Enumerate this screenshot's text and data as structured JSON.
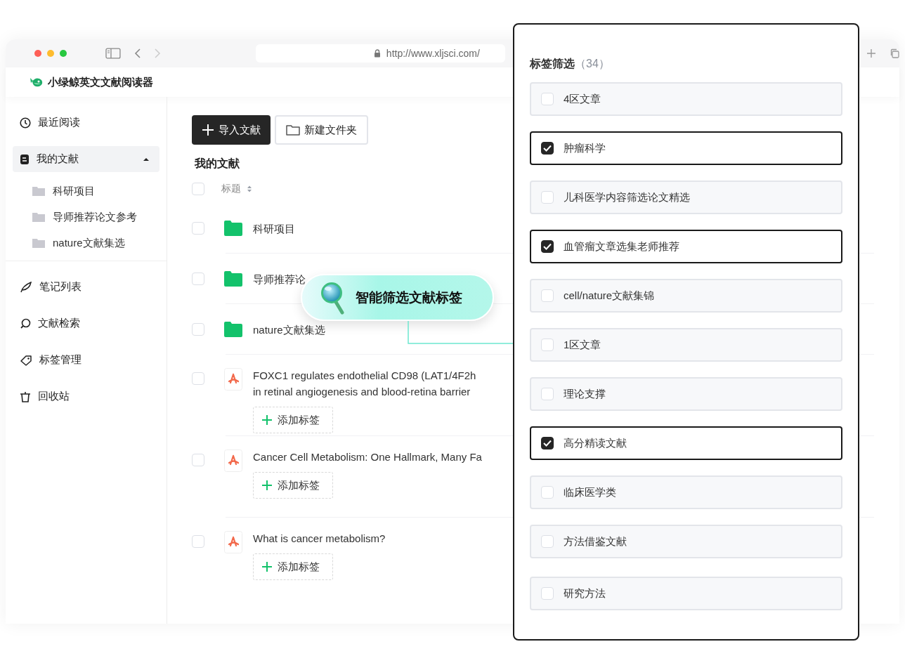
{
  "browser": {
    "url": "http://www.xljsci.com/"
  },
  "app": {
    "title": "小绿鲸英文文献阅读器"
  },
  "sidebar": {
    "items": [
      {
        "label": "最近阅读",
        "selected": false
      },
      {
        "label": "我的文献",
        "selected": true,
        "expanded": true,
        "children": [
          {
            "label": "科研项目"
          },
          {
            "label": "导师推荐论文参考"
          },
          {
            "label": "nature文献集选"
          }
        ]
      },
      {
        "label": "笔记列表",
        "selected": false
      },
      {
        "label": "文献检索",
        "selected": false
      },
      {
        "label": "标签管理",
        "selected": false
      },
      {
        "label": "回收站",
        "selected": false
      }
    ]
  },
  "toolbar": {
    "buttons": [
      {
        "label": "导入文献",
        "kind": "primary"
      },
      {
        "label": "新建文件夹",
        "kind": "folder"
      }
    ]
  },
  "section_title": "我的文献",
  "table": {
    "select_all": {
      "checked": false
    },
    "columns": [
      {
        "label": "标题",
        "sortable": true
      }
    ],
    "rows": [
      {
        "kind": "folder",
        "title_lines": [
          "科研项目"
        ],
        "checked": false
      },
      {
        "kind": "folder",
        "title_lines": [
          "导师推荐论"
        ],
        "checked": false
      },
      {
        "kind": "folder",
        "title_lines": [
          "nature文献集选"
        ],
        "checked": false
      },
      {
        "kind": "pdf",
        "title_lines": [
          "FOXC1 regulates endothelial CD98 (LAT1/4F2h",
          "in retinal angiogenesis and blood-retina barrier"
        ],
        "checked": false,
        "tag_button": "添加标签"
      },
      {
        "kind": "pdf",
        "title_lines": [
          "Cancer Cell Metabolism: One Hallmark, Many Fa"
        ],
        "checked": false,
        "tag_button": "添加标签"
      },
      {
        "kind": "pdf",
        "title_lines": [
          "What is cancer metabolism?"
        ],
        "checked": false,
        "tag_button": "添加标签"
      }
    ]
  },
  "callout": {
    "label": "智能筛选文献标签"
  },
  "tag_filter": {
    "title": "标签筛选",
    "count": "（34）",
    "tags": [
      {
        "label": "4区文章",
        "checked": false
      },
      {
        "label": "肿瘤科学",
        "checked": true
      },
      {
        "label": "儿科医学内容筛选论文精选",
        "checked": false
      },
      {
        "label": "血管瘤文章选集老师推荐",
        "checked": true
      },
      {
        "label": "cell/nature文献集锦",
        "checked": false
      },
      {
        "label": "1区文章",
        "checked": false
      },
      {
        "label": "理论支撑",
        "checked": false
      },
      {
        "label": "高分精读文献",
        "checked": true
      },
      {
        "label": "临床医学类",
        "checked": false
      },
      {
        "label": "方法借鉴文献",
        "checked": false
      },
      {
        "label": "研究方法",
        "checked": false
      }
    ]
  }
}
